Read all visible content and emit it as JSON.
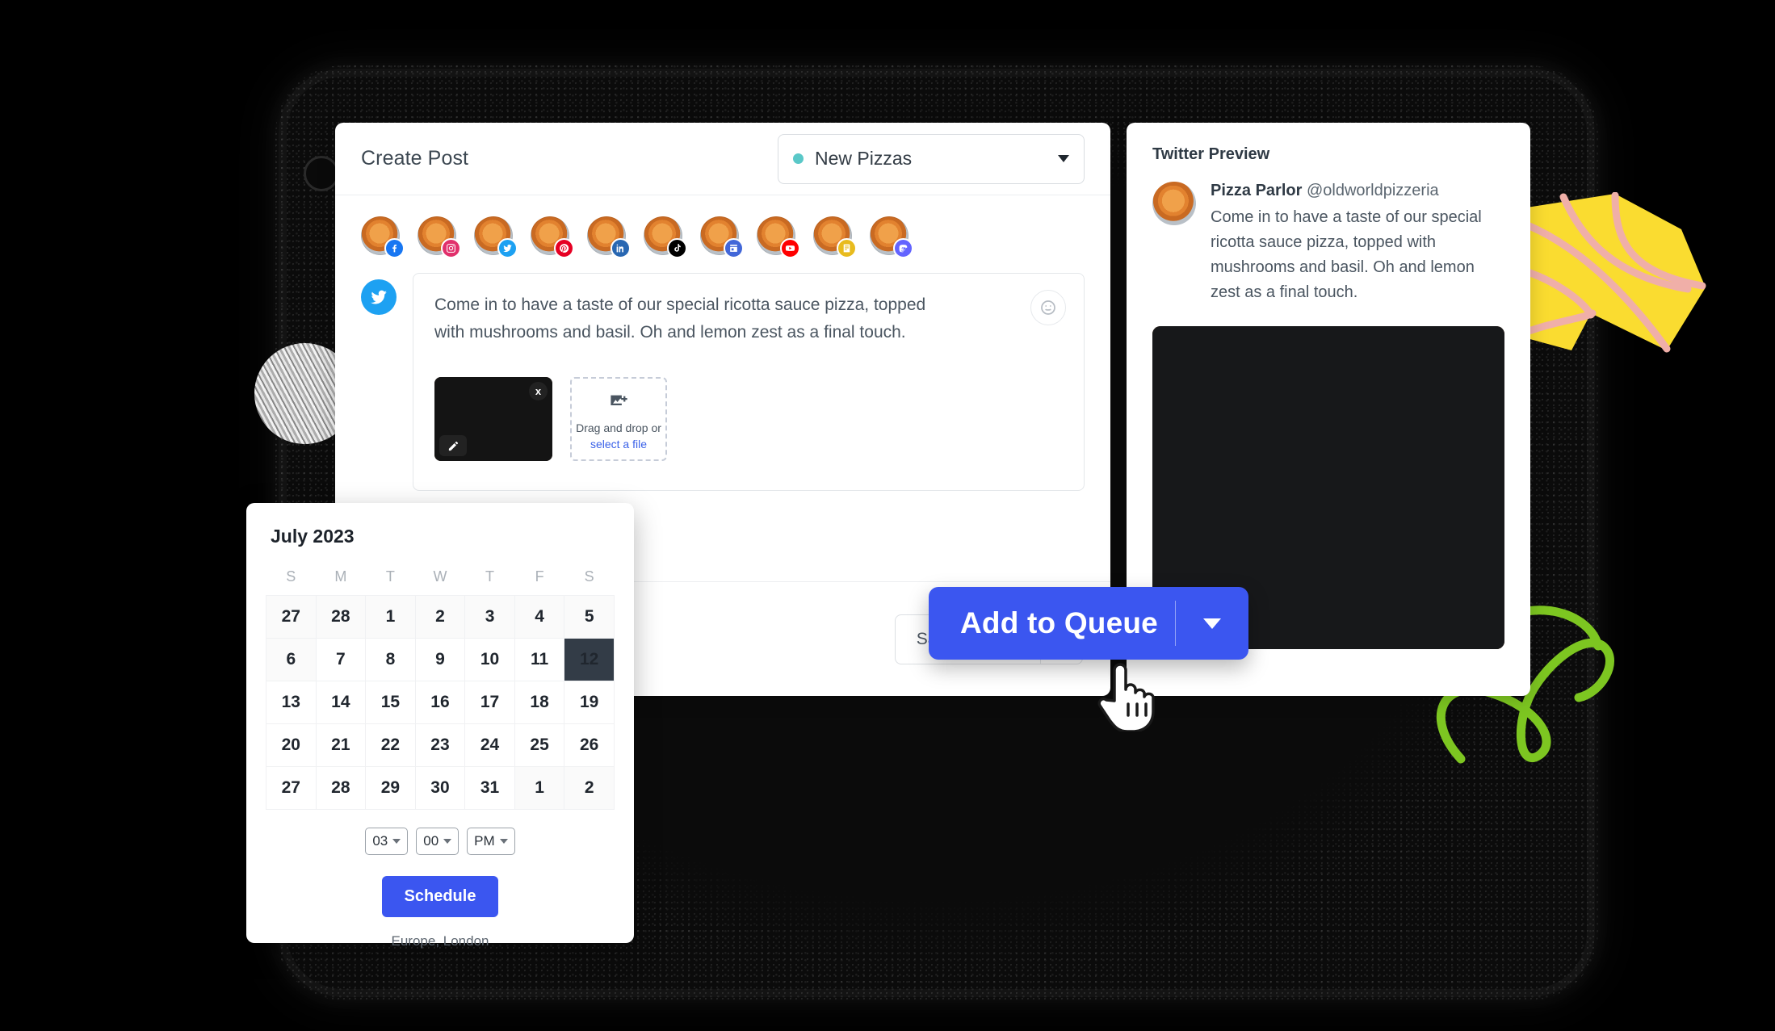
{
  "composer": {
    "title": "Create Post",
    "campaign": {
      "label": "New Pizzas",
      "dot_color": "#5ac8c8"
    },
    "accounts": [
      {
        "platform": "facebook",
        "color": "#1877F2",
        "glyph": "f"
      },
      {
        "platform": "instagram",
        "color": "#E1306C",
        "glyph": "▢"
      },
      {
        "platform": "twitter",
        "color": "#1DA1F2",
        "glyph": "ᴠ"
      },
      {
        "platform": "pinterest",
        "color": "#E60023",
        "glyph": "P"
      },
      {
        "platform": "linkedin",
        "color": "#2867B2",
        "glyph": "in"
      },
      {
        "platform": "tiktok",
        "color": "#000000",
        "glyph": "♪"
      },
      {
        "platform": "facebook-page",
        "color": "#4267D8",
        "glyph": "▤"
      },
      {
        "platform": "youtube",
        "color": "#FF0000",
        "glyph": "▶"
      },
      {
        "platform": "google-business",
        "color": "#E8BB1E",
        "glyph": "▦"
      },
      {
        "platform": "mastodon",
        "color": "#6364FF",
        "glyph": "m"
      }
    ],
    "active_platform": "twitter",
    "post_text": "Come in to have a taste of our special ricotta sauce pizza, topped with mushrooms and basil. Oh and lemon zest as a final touch.",
    "emoji_button": "emoji-picker",
    "attachment": {
      "remove_label": "x",
      "edit_label": "edit"
    },
    "dropzone": {
      "line1": "Drag and drop or",
      "link": "select a file"
    },
    "footer": {
      "save_draft_label": "Save as Draft",
      "queue_label": "Add to Queue",
      "queue_color": "#3b56f0"
    }
  },
  "preview": {
    "title": "Twitter Preview",
    "account_name": "Pizza Parlor",
    "handle": "@oldworldpizzeria",
    "text": "Come in to have a taste of our special ricotta sauce pizza, topped with mushrooms and basil. Oh and lemon zest as a final touch."
  },
  "calendar": {
    "month_title": "July 2023",
    "weekdays": [
      "S",
      "M",
      "T",
      "W",
      "T",
      "F",
      "S"
    ],
    "weeks": [
      [
        {
          "d": "27",
          "s": "muted"
        },
        {
          "d": "28",
          "s": "muted"
        },
        {
          "d": "1",
          "s": "muted"
        },
        {
          "d": "2",
          "s": "muted"
        },
        {
          "d": "3",
          "s": "muted"
        },
        {
          "d": "4",
          "s": "muted"
        },
        {
          "d": "5",
          "s": "muted"
        }
      ],
      [
        {
          "d": "6",
          "s": "muted"
        },
        {
          "d": "7",
          "s": "today"
        },
        {
          "d": "8",
          "s": ""
        },
        {
          "d": "9",
          "s": ""
        },
        {
          "d": "10",
          "s": ""
        },
        {
          "d": "11",
          "s": ""
        },
        {
          "d": "12",
          "s": "selected"
        }
      ],
      [
        {
          "d": "13",
          "s": ""
        },
        {
          "d": "14",
          "s": ""
        },
        {
          "d": "15",
          "s": ""
        },
        {
          "d": "16",
          "s": ""
        },
        {
          "d": "17",
          "s": ""
        },
        {
          "d": "18",
          "s": ""
        },
        {
          "d": "19",
          "s": ""
        }
      ],
      [
        {
          "d": "20",
          "s": ""
        },
        {
          "d": "21",
          "s": ""
        },
        {
          "d": "22",
          "s": ""
        },
        {
          "d": "23",
          "s": ""
        },
        {
          "d": "24",
          "s": ""
        },
        {
          "d": "25",
          "s": ""
        },
        {
          "d": "26",
          "s": ""
        }
      ],
      [
        {
          "d": "27",
          "s": ""
        },
        {
          "d": "28",
          "s": ""
        },
        {
          "d": "29",
          "s": ""
        },
        {
          "d": "30",
          "s": ""
        },
        {
          "d": "31",
          "s": ""
        },
        {
          "d": "1",
          "s": "muted"
        },
        {
          "d": "2",
          "s": "muted"
        }
      ]
    ],
    "time": {
      "hour": "03",
      "minute": "00",
      "meridiem": "PM"
    },
    "schedule_label": "Schedule",
    "timezone": "Europe, London"
  },
  "decor": {
    "leaf_color": "#FADC30",
    "leaf_vein_color": "#F0AFA8",
    "squiggle_color": "#7DC621"
  }
}
